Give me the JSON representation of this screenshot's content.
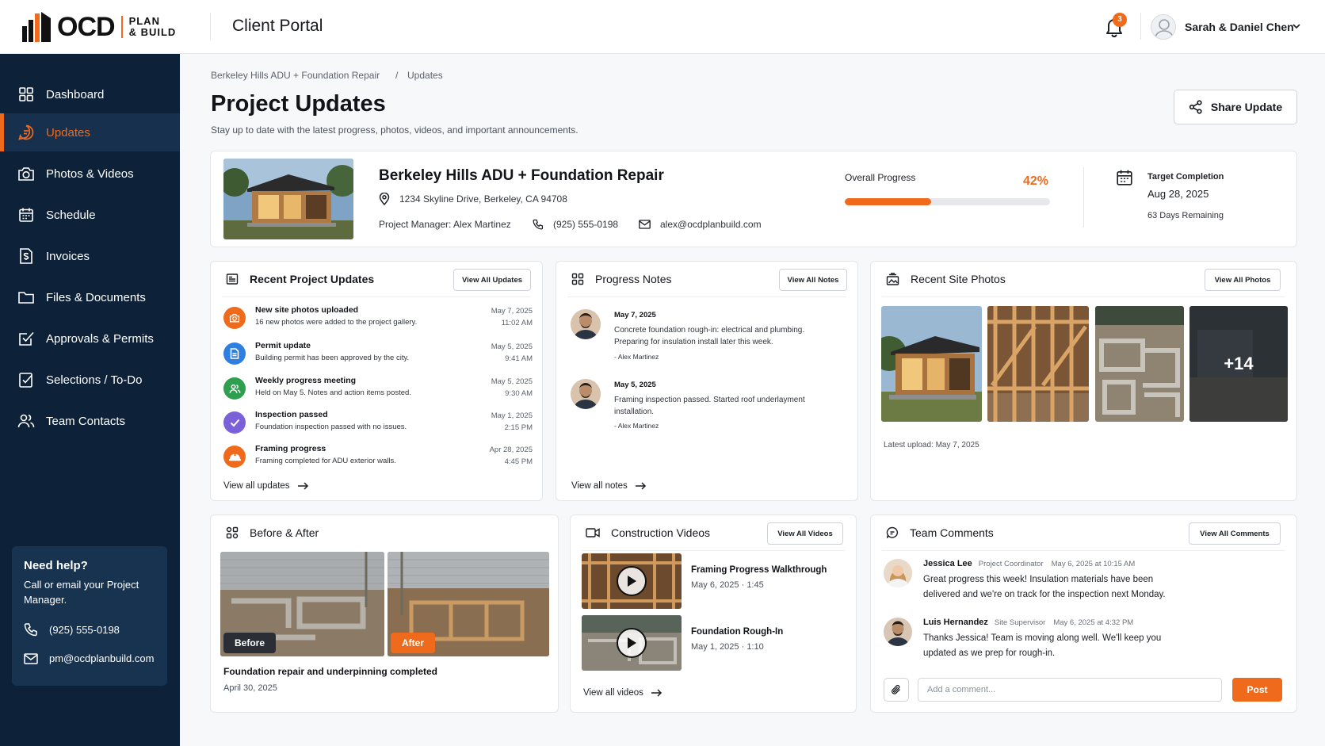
{
  "header": {
    "logo_main": "OCD",
    "logo_sub_1": "PLAN",
    "logo_sub_2": "& BUILD",
    "portal_title": "Client Portal",
    "notification_count": "3",
    "user_name": "Sarah & Daniel Chen"
  },
  "sidebar": {
    "items": [
      {
        "label": "Dashboard",
        "icon": "grid-icon"
      },
      {
        "label": "Updates",
        "icon": "chat-bubble-icon",
        "active": true
      },
      {
        "label": "Photos & Videos",
        "icon": "camera-icon"
      },
      {
        "label": "Schedule",
        "icon": "calendar-icon"
      },
      {
        "label": "Invoices",
        "icon": "invoice-icon"
      },
      {
        "label": "Files & Documents",
        "icon": "folder-icon"
      },
      {
        "label": "Approvals & Permits",
        "icon": "check-square-icon"
      },
      {
        "label": "Selections / To-Do",
        "icon": "checklist-icon"
      },
      {
        "label": "Team Contacts",
        "icon": "users-icon"
      }
    ],
    "help": {
      "title": "Need help?",
      "text": "Call or email your Project Manager.",
      "phone": "(925) 555-0198",
      "email": "pm@ocdplanbuild.com"
    }
  },
  "breadcrumb": {
    "project": "Berkeley Hills ADU + Foundation Repair",
    "separator": "/",
    "current": "Updates"
  },
  "page": {
    "title": "Project Updates",
    "subtitle": "Stay up to date with the latest progress, photos, videos, and important announcements.",
    "share_label": "Share Update"
  },
  "project": {
    "name": "Berkeley Hills ADU + Foundation Repair",
    "address": "1234 Skyline Drive, Berkeley, CA 94708",
    "manager": "Project Manager: Alex Martinez",
    "phone": "(925) 555-0198",
    "email": "alex@ocdplanbuild.com",
    "progress_label": "Overall Progress",
    "progress_pct": "42%",
    "progress_value": 0.42,
    "target_label": "Target Completion",
    "target_date": "Aug 28, 2025",
    "days_remaining": "63 Days Remaining"
  },
  "updates": {
    "title": "Recent Project Updates",
    "view_all": "View All Updates",
    "items": [
      {
        "title": "New site photos uploaded",
        "desc": "16 new photos were added to the project gallery.",
        "date": "May 7, 2025",
        "time": "11:02 AM",
        "icon": "camera-icon",
        "color": "#f06a1b"
      },
      {
        "title": "Permit update",
        "desc": "Building permit has been approved by the city.",
        "date": "May 5, 2025",
        "time": "9:41 AM",
        "icon": "document-icon",
        "color": "#2f7fe0"
      },
      {
        "title": "Weekly progress meeting",
        "desc": "Held on May 5. Notes and action items posted.",
        "date": "May 5, 2025",
        "time": "9:30 AM",
        "icon": "users-icon",
        "color": "#2e9e4f"
      },
      {
        "title": "Inspection passed",
        "desc": "Foundation inspection passed with no issues.",
        "date": "May 1, 2025",
        "time": "2:15 PM",
        "icon": "checkmark-icon",
        "color": "#7b61d9"
      },
      {
        "title": "Framing progress",
        "desc": "Framing completed for ADU exterior walls.",
        "date": "Apr 28, 2025",
        "time": "4:45 PM",
        "icon": "hardhat-icon",
        "color": "#f06a1b"
      }
    ],
    "view_link": "View all updates"
  },
  "notes": {
    "title": "Progress Notes",
    "view_all": "View All Notes",
    "items": [
      {
        "date": "May 7, 2025",
        "text": "Concrete foundation rough-in: electrical and plumbing. Preparing for insulation install later this week.",
        "author": "- Alex Martinez"
      },
      {
        "date": "May 5, 2025",
        "text": "Framing inspection passed. Started roof underlayment installation.",
        "author": "- Alex Martinez"
      }
    ],
    "view_link": "View all notes"
  },
  "photos": {
    "title": "Recent Site Photos",
    "view_all": "View All Photos",
    "more_count": "+14",
    "latest": "Latest upload: May 7, 2025"
  },
  "before_after": {
    "title": "Before & After",
    "before_label": "Before",
    "after_label": "After",
    "caption": "Foundation repair and underpinning completed",
    "date": "April 30, 2025"
  },
  "videos": {
    "title": "Construction Videos",
    "view_all": "View All Videos",
    "items": [
      {
        "title": "Framing Progress Walkthrough",
        "meta": "May 6, 2025  ·  1:45"
      },
      {
        "title": "Foundation Rough-In",
        "meta": "May 1, 2025  ·  1:10"
      }
    ],
    "view_link": "View all videos"
  },
  "comments": {
    "title": "Team Comments",
    "view_all": "View All Comments",
    "items": [
      {
        "name": "Jessica Lee",
        "role": "Project Coordinator",
        "time": "May 6, 2025 at 10:15 AM",
        "text": "Great progress this week! Insulation materials have been delivered and we're on track for the inspection next Monday."
      },
      {
        "name": "Luis Hernandez",
        "role": "Site Supervisor",
        "time": "May 6, 2025 at 4:32 PM",
        "text": "Thanks Jessica! Team is moving along well. We'll keep you updated as we prep for rough-in."
      }
    ],
    "input_placeholder": "Add a comment...",
    "post_label": "Post"
  },
  "colors": {
    "accent": "#f06a1b",
    "sidebar_bg": "#0d2239"
  }
}
